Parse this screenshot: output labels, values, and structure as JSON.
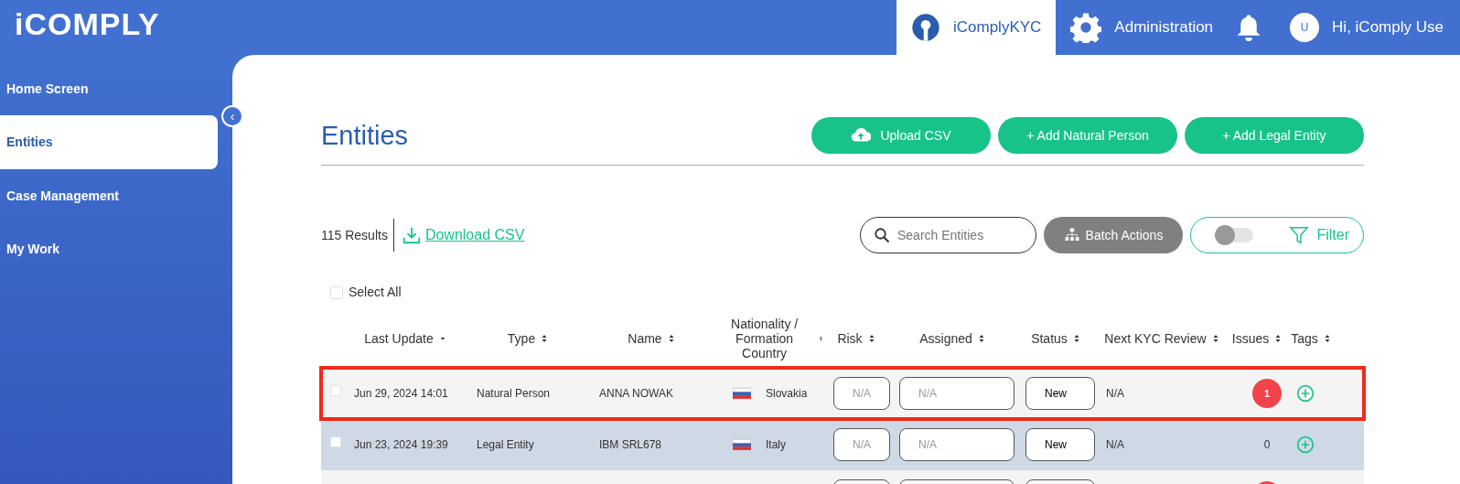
{
  "logo": "iCOMPLY",
  "topnav": [
    {
      "kind": "app",
      "label": "iComplyKYC",
      "selected": true
    },
    {
      "kind": "gear",
      "label": "Administration",
      "selected": false
    },
    {
      "kind": "bell",
      "selected": false
    },
    {
      "kind": "user",
      "avatar": "U",
      "label": "Hi, iComply Use",
      "selected": false
    }
  ],
  "sidebar": {
    "items": [
      {
        "label": "Home Screen",
        "selected": false
      },
      {
        "label": "Entities",
        "selected": true
      },
      {
        "label": "Case Management",
        "selected": false
      },
      {
        "label": "My Work",
        "selected": false
      }
    ],
    "collapse_icon": "‹"
  },
  "page": {
    "title": "Entities",
    "buttons": [
      {
        "kind": "upload",
        "label": "Upload CSV"
      },
      {
        "kind": "add",
        "label": "+ Add Natural Person"
      },
      {
        "kind": "add",
        "label": "+ Add Legal Entity"
      }
    ]
  },
  "toolbar": {
    "results": "115 Results",
    "download": "Download CSV",
    "search": {
      "placeholder": "Search Entities"
    },
    "batch": "Batch Actions",
    "filter_toggle_on": false,
    "filter": "Filter"
  },
  "select_all": {
    "label": "Select All",
    "checked": false
  },
  "table": {
    "columns": [
      {
        "label": "Last Update",
        "sorted": true
      },
      {
        "label": "Type",
        "sorted": false
      },
      {
        "label": "Name",
        "sorted": false
      },
      {
        "label": "Nationality / Formation Country",
        "sorted": false
      },
      {
        "label": "Risk",
        "sorted": false
      },
      {
        "label": "Assigned",
        "sorted": false
      },
      {
        "label": "Status",
        "sorted": false
      },
      {
        "label": "Next KYC Review",
        "sorted": false
      },
      {
        "label": "Issues",
        "sorted": false
      },
      {
        "label": "Tags",
        "sorted": false
      }
    ],
    "rows": [
      {
        "checked": false,
        "highlighted": true,
        "last_update": "Jun 29, 2024 14:01",
        "type": "Natural Person",
        "name": "ANNA NOWAK",
        "country": "Slovakia",
        "risk": {
          "placeholder": "N/A"
        },
        "assigned": {
          "placeholder": "N/A"
        },
        "status": "New",
        "next_review": "N/A",
        "issues": "1",
        "issues_alert": true
      },
      {
        "checked": false,
        "highlighted": false,
        "last_update": "Jun 23, 2024 19:39",
        "type": "Legal Entity",
        "name": "IBM SRL678",
        "country": "Italy",
        "risk": {
          "placeholder": "N/A"
        },
        "assigned": {
          "placeholder": "N/A"
        },
        "status": "New",
        "next_review": "N/A",
        "issues": "0",
        "issues_alert": false
      },
      {
        "issues_alert": true
      }
    ]
  }
}
